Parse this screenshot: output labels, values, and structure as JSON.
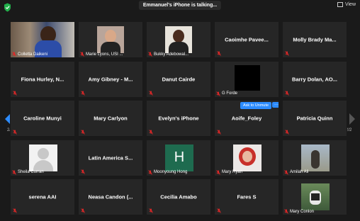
{
  "topbar": {
    "talking": "Emmanuel's iPhone is talking...",
    "view_label": "View"
  },
  "nav": {
    "page_left": "2/2",
    "page_right": "2/2"
  },
  "tiles": [
    {
      "name": "Colletta Daikeni",
      "mode": "video"
    },
    {
      "name": "Marie Lyons, USI ...",
      "mode": "video"
    },
    {
      "name": "Bukky Adebowal...",
      "mode": "video"
    },
    {
      "name": "Caoimhe Pavee...",
      "mode": "name"
    },
    {
      "name": "Molly Brady Ma...",
      "mode": "name"
    },
    {
      "name": "Fiona Hurley, N...",
      "mode": "name"
    },
    {
      "name": "Amy Gibney - M...",
      "mode": "name"
    },
    {
      "name": "Danut Cairde",
      "mode": "name"
    },
    {
      "name": "G Forde",
      "mode": "black"
    },
    {
      "name": "Barry Dolan, AO...",
      "mode": "name"
    },
    {
      "name": "Caroline Munyi",
      "mode": "name"
    },
    {
      "name": "Mary Carlyon",
      "mode": "name"
    },
    {
      "name": "Evelyn's iPhone",
      "mode": "name"
    },
    {
      "name": "Aoife_Foley",
      "mode": "name"
    },
    {
      "name": "Patricia Quinn",
      "mode": "name"
    },
    {
      "name": "Sheila Curran",
      "mode": "avatar"
    },
    {
      "name": "Latin America S...",
      "mode": "name"
    },
    {
      "name": "Moonyoung Hong",
      "mode": "letter",
      "letter": "H"
    },
    {
      "name": "Mary Ryan",
      "mode": "photo"
    },
    {
      "name": "Amilah Ali",
      "mode": "photo"
    },
    {
      "name": "serena AAI",
      "mode": "name"
    },
    {
      "name": "Neasa Candon (...",
      "mode": "name"
    },
    {
      "name": "Cecilia Amabo",
      "mode": "name"
    },
    {
      "name": "Fares S",
      "mode": "name"
    },
    {
      "name": "Mary Conlon",
      "mode": "photo"
    }
  ],
  "ask_unmute": "Ask to Unmute",
  "more_label": "···",
  "colors": {
    "accent": "#2d8cff",
    "muted_mic": "#e02828",
    "letter_tile": "#1e6b4f"
  }
}
